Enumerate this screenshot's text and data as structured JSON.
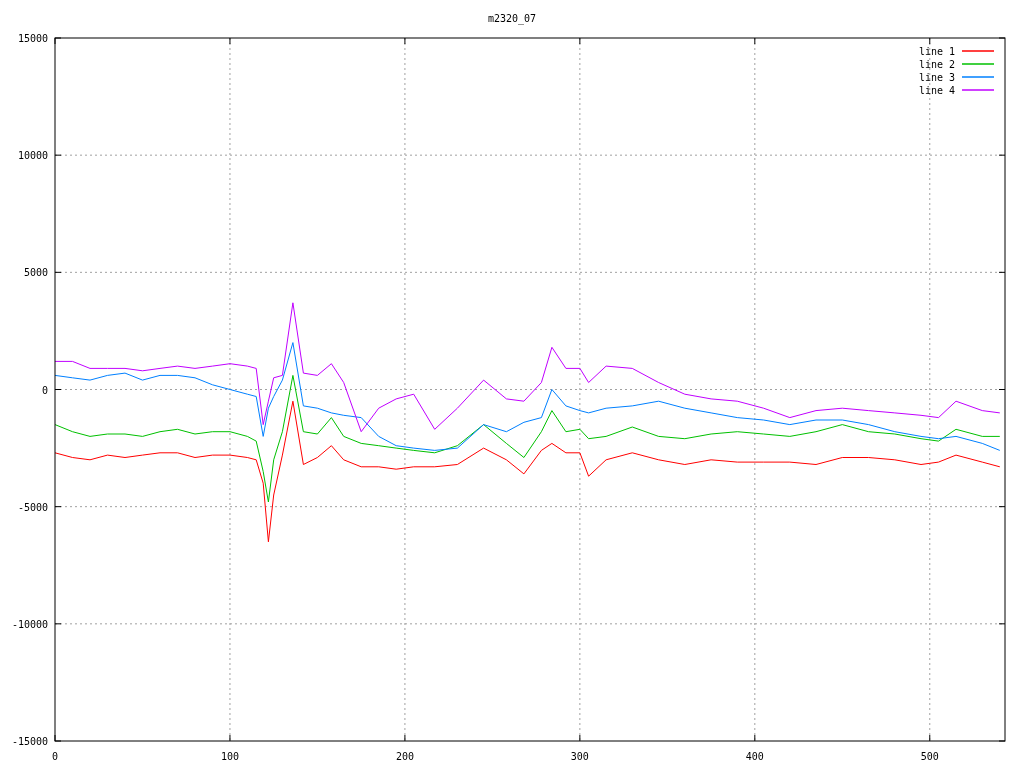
{
  "chart": {
    "chart_data": {
      "type": "line",
      "title": "m2320_07",
      "x": [
        0,
        10,
        20,
        30,
        40,
        50,
        60,
        70,
        80,
        90,
        100,
        110,
        115,
        119,
        122,
        125,
        130,
        136,
        142,
        150,
        158,
        165,
        175,
        185,
        195,
        205,
        217,
        230,
        245,
        258,
        268,
        278,
        284,
        292,
        300,
        305,
        315,
        330,
        345,
        360,
        375,
        390,
        405,
        420,
        435,
        450,
        465,
        480,
        495,
        505,
        515,
        530,
        540
      ],
      "series": [
        {
          "name": "line 1",
          "color": "#ff0000",
          "values": [
            -2700,
            -2900,
            -3000,
            -2800,
            -2900,
            -2800,
            -2700,
            -2700,
            -2900,
            -2800,
            -2800,
            -2900,
            -3000,
            -4000,
            -6500,
            -4500,
            -2800,
            -500,
            -3200,
            -2900,
            -2400,
            -3000,
            -3300,
            -3300,
            -3400,
            -3300,
            -3300,
            -3200,
            -2500,
            -3000,
            -3600,
            -2600,
            -2300,
            -2700,
            -2700,
            -3700,
            -3000,
            -2700,
            -3000,
            -3200,
            -3000,
            -3100,
            -3100,
            -3100,
            -3200,
            -2900,
            -2900,
            -3000,
            -3200,
            -3100,
            -2800,
            -3100,
            -3300
          ]
        },
        {
          "name": "line 2",
          "color": "#00c000",
          "values": [
            -1500,
            -1800,
            -2000,
            -1900,
            -1900,
            -2000,
            -1800,
            -1700,
            -1900,
            -1800,
            -1800,
            -2000,
            -2200,
            -3500,
            -4800,
            -3000,
            -1800,
            600,
            -1800,
            -1900,
            -1200,
            -2000,
            -2300,
            -2400,
            -2500,
            -2600,
            -2700,
            -2400,
            -1500,
            -2300,
            -2900,
            -1800,
            -900,
            -1800,
            -1700,
            -2100,
            -2000,
            -1600,
            -2000,
            -2100,
            -1900,
            -1800,
            -1900,
            -2000,
            -1800,
            -1500,
            -1800,
            -1900,
            -2100,
            -2200,
            -1700,
            -2000,
            -2000
          ]
        },
        {
          "name": "line 3",
          "color": "#0080ff",
          "values": [
            600,
            500,
            400,
            600,
            700,
            400,
            600,
            600,
            500,
            200,
            0,
            -200,
            -300,
            -2000,
            -800,
            -300,
            400,
            2000,
            -700,
            -800,
            -1000,
            -1100,
            -1200,
            -2000,
            -2400,
            -2500,
            -2600,
            -2500,
            -1500,
            -1800,
            -1400,
            -1200,
            0,
            -700,
            -900,
            -1000,
            -800,
            -700,
            -500,
            -800,
            -1000,
            -1200,
            -1300,
            -1500,
            -1300,
            -1300,
            -1500,
            -1800,
            -2000,
            -2100,
            -2000,
            -2300,
            -2600
          ]
        },
        {
          "name": "line 4",
          "color": "#c000ff",
          "values": [
            1200,
            1200,
            900,
            900,
            900,
            800,
            900,
            1000,
            900,
            1000,
            1100,
            1000,
            900,
            -1500,
            -500,
            500,
            600,
            3700,
            700,
            600,
            1100,
            300,
            -1800,
            -800,
            -400,
            -200,
            -1700,
            -800,
            400,
            -400,
            -500,
            300,
            1800,
            900,
            900,
            300,
            1000,
            900,
            300,
            -200,
            -400,
            -500,
            -800,
            -1200,
            -900,
            -800,
            -900,
            -1000,
            -1100,
            -1200,
            -500,
            -900,
            -1000
          ]
        }
      ],
      "grid": true,
      "legend": true,
      "xlim": [
        0,
        543
      ],
      "ylim": [
        -15000,
        15000
      ],
      "xticks": [
        0,
        100,
        200,
        300,
        400,
        500
      ],
      "yticks": [
        -15000,
        -10000,
        -5000,
        0,
        5000,
        10000,
        15000
      ]
    }
  }
}
